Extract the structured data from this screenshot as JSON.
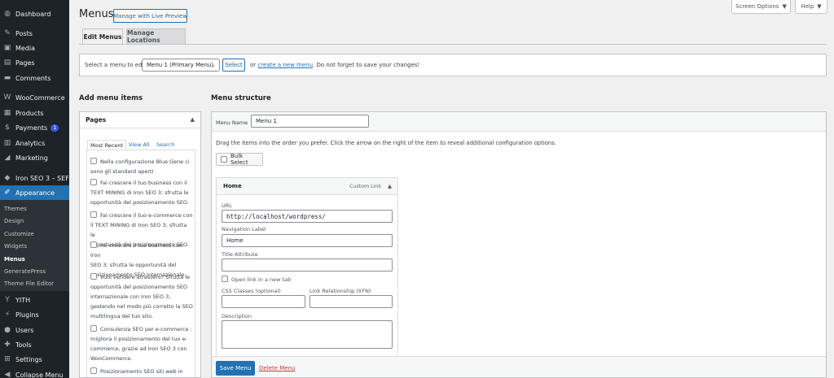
{
  "sidebar": {
    "items": [
      {
        "label": "Dashboard",
        "icon": "dashboard-icon"
      },
      {
        "label": "Posts",
        "icon": "pin-icon"
      },
      {
        "label": "Media",
        "icon": "media-icon"
      },
      {
        "label": "Pages",
        "icon": "pages-icon"
      },
      {
        "label": "Comments",
        "icon": "comments-icon"
      },
      {
        "label": "WooCommerce",
        "icon": "woocommerce-icon"
      },
      {
        "label": "Products",
        "icon": "products-icon"
      },
      {
        "label": "Payments",
        "icon": "payments-icon",
        "badge": "1"
      },
      {
        "label": "Analytics",
        "icon": "analytics-icon"
      },
      {
        "label": "Marketing",
        "icon": "marketing-icon"
      },
      {
        "label": "Iron SEO 3 – SEF",
        "icon": "seo-icon"
      },
      {
        "label": "Appearance",
        "icon": "appearance-icon"
      },
      {
        "label": "YITH",
        "icon": "yith-icon"
      },
      {
        "label": "Plugins",
        "icon": "plugins-icon"
      },
      {
        "label": "Users",
        "icon": "users-icon"
      },
      {
        "label": "Tools",
        "icon": "tools-icon"
      },
      {
        "label": "Settings",
        "icon": "settings-icon"
      },
      {
        "label": "Collapse Menu",
        "icon": "collapse-icon"
      }
    ],
    "appearance_sub": [
      "Themes",
      "Design",
      "Customize",
      "Widgets",
      "Menus",
      "GeneratePress",
      "Theme File Editor"
    ]
  },
  "header": {
    "title": "Menus",
    "live_preview": "Manage with Live Preview",
    "screen_options": "Screen Options",
    "help": "Help"
  },
  "tabs": [
    "Edit Menus",
    "Manage Locations"
  ],
  "select_menu": {
    "label": "Select a menu to edit:",
    "value": "Menu 1 (Primary Menu)",
    "select_btn": "Select",
    "or": "or",
    "create_link": "create a new menu",
    "note": ". Do not forget to save your changes!"
  },
  "add_items": {
    "heading": "Add menu items",
    "box_title": "Pages",
    "tabs": [
      "Most Recent",
      "View All",
      "Search"
    ],
    "pages": [
      {
        "lines": [
          "Nella configurazione Blue Gene ci",
          "sono gli standard aperti"
        ]
      },
      {
        "lines": [
          "Fai crescere il tuo business con il",
          "TEXT MINING di Iron SEO 3; sfrutta le",
          "opportunità del posizionamento SEO."
        ]
      },
      {
        "lines": [
          "Fai crescere il tuo e-commerce con",
          "il TEXT MINING di Iron SEO 3; sfrutta le",
          "opportunità del posizionamento SEO."
        ]
      },
      {
        "lines": [
          "Fai crescere il tuo business con Iron",
          "SEO 3; sfrutta le opportunità del",
          "posizionamento SEO internazionale."
        ]
      },
      {
        "lines": [
          "Vuoi vendere all'estero? Sfrutta le",
          "opportunità del posizionamento SEO",
          "internazionale con Iron SEO 3,",
          "gestendo nel modo più corretto la SEO",
          "multilingua del tuo sito."
        ]
      },
      {
        "lines": [
          "Consulenza SEO per e-commerce :",
          "migliora il posizionamento del tuo e-",
          "commerce, grazie ad Iron SEO 3 con",
          "WooCommerce."
        ]
      },
      {
        "lines": [
          "Posizionamento SEO siti web in"
        ]
      }
    ]
  },
  "structure": {
    "heading": "Menu structure",
    "menu_name_label": "Menu Name",
    "menu_name_value": "Menu 1",
    "hint": "Drag the items into the order you prefer. Click the arrow on the right of the item to reveal additional configuration options.",
    "bulk_select": "Bulk Select",
    "item": {
      "title": "Home",
      "type": "Custom Link",
      "url_label": "URL",
      "url_value": "http://localhost/wordpress/",
      "nav_label": "Navigation Label",
      "nav_value": "Home",
      "title_attr_label": "Title Attribute",
      "new_tab": "Open link in a new tab",
      "css_label": "CSS Classes (optional)",
      "xfn_label": "Link Relationship (XFN)",
      "desc_label": "Description"
    },
    "save": "Save Menu",
    "delete": "Delete Menu"
  },
  "colors": {
    "accent": "#2271b1",
    "sidebar": "#1d2327",
    "danger": "#d63638"
  }
}
